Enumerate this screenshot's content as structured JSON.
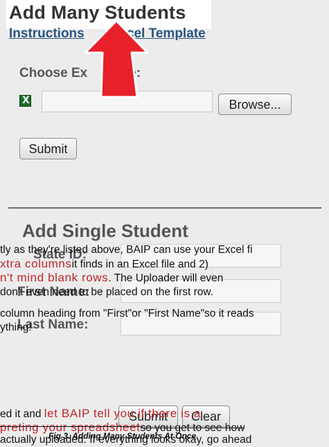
{
  "colors": {
    "panel_bg": "#ececec",
    "link": "#2a5580",
    "arrow": "#e8202a",
    "overlay_red": "#c0262c"
  },
  "header": {
    "title": "Add Many Students",
    "links": {
      "instructions": "Instructions",
      "template": "Excel Template"
    }
  },
  "file_section": {
    "label_left": "Choose Ex",
    "label_right": "File:",
    "file_icon": "excel-icon",
    "browse_label": "Browse...",
    "submit_label": "Submit"
  },
  "single_section": {
    "title": "Add Single Student",
    "state_label": "State ID:",
    "first_label": "First Name:",
    "last_label": "Last Name:",
    "submit_label": "Submit",
    "clear_label": "Clear"
  },
  "overlay_text": {
    "l1": "tly as they're listed above, BAIP can use your Excel fi",
    "l2_red": "xtra columns",
    "l2": "it finds in an Excel file and 2)",
    "l3_red": "n't mind blank rows",
    "l3": ". The Uploader will even",
    "l4": "don't even need to be placed on the first row.",
    "l5": "column heading from \"First\"or \"First Name\"so it reads",
    "l6": "ything!",
    "l7": "ed it and ",
    "l7_red": "let BAIP tell you if there is a",
    "l8_red": "preting your spreadsheet",
    "l8": "so you get to see how",
    "caption": "Fig 3. Adding Many Students At Once",
    "l9": "actually uploaded. If everything looks okay, go ahead"
  }
}
